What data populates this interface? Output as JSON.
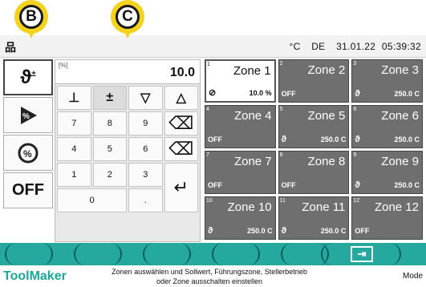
{
  "topbar": {
    "network_icon": "network-icon",
    "unit": "°C",
    "lang": "DE",
    "date": "31.01.22",
    "time": "05:39:32"
  },
  "left_buttons": [
    {
      "icon": "setpoint-icon",
      "label": "",
      "active": true
    },
    {
      "icon": "percent-play-icon",
      "label": ""
    },
    {
      "icon": "gauge-percent-icon",
      "label": ""
    },
    {
      "icon": "",
      "label": "OFF"
    }
  ],
  "editor": {
    "unit": "[%]",
    "value": "10.0"
  },
  "keypad": {
    "keys": [
      "⊥",
      "±",
      "▽",
      "△",
      "7",
      "8",
      "9",
      "⌫",
      "4",
      "5",
      "6",
      "⌫",
      "1",
      "2",
      "3",
      "↵",
      "0",
      "."
    ]
  },
  "zones": [
    {
      "number": "1",
      "title": "Zone 1",
      "icon": "⊘",
      "value": "10.0 %",
      "off": "",
      "selected": true
    },
    {
      "number": "2",
      "title": "Zone 2",
      "icon": "",
      "value": "",
      "off": "OFF"
    },
    {
      "number": "3",
      "title": "Zone 3",
      "icon": "ϑ",
      "value": "250.0 C",
      "off": ""
    },
    {
      "number": "4",
      "title": "Zone 4",
      "icon": "",
      "value": "",
      "off": "OFF"
    },
    {
      "number": "5",
      "title": "Zone 5",
      "icon": "ϑ",
      "value": "250.0 C",
      "off": ""
    },
    {
      "number": "6",
      "title": "Zone 6",
      "icon": "ϑ",
      "value": "250.0 C",
      "off": ""
    },
    {
      "number": "7",
      "title": "Zone 7",
      "icon": "",
      "value": "",
      "off": "OFF"
    },
    {
      "number": "8",
      "title": "Zone 8",
      "icon": "",
      "value": "",
      "off": "OFF"
    },
    {
      "number": "9",
      "title": "Zone 9",
      "icon": "ϑ",
      "value": "250.0 C",
      "off": ""
    },
    {
      "number": "10",
      "title": "Zone 10",
      "icon": "ϑ",
      "value": "250.0 C",
      "off": ""
    },
    {
      "number": "11",
      "title": "Zone 11",
      "icon": "ϑ",
      "value": "250.0 C",
      "off": ""
    },
    {
      "number": "12",
      "title": "Zone 12",
      "icon": "",
      "value": "",
      "off": "OFF"
    }
  ],
  "footer": {
    "brand": "ToolMaker",
    "hint_line1": "Zonen auswählen und Sollwert, Führungszone, Stellerbetrieb",
    "hint_line2": "oder Zone ausschalten einstellen",
    "mode": "Mode"
  },
  "markers": [
    {
      "letter": "B"
    },
    {
      "letter": "C"
    }
  ],
  "colors": {
    "accent": "#25a89d",
    "brand": "#19a89c",
    "zone_bg": "#6f6f6f",
    "marker": "#f2d21c"
  }
}
